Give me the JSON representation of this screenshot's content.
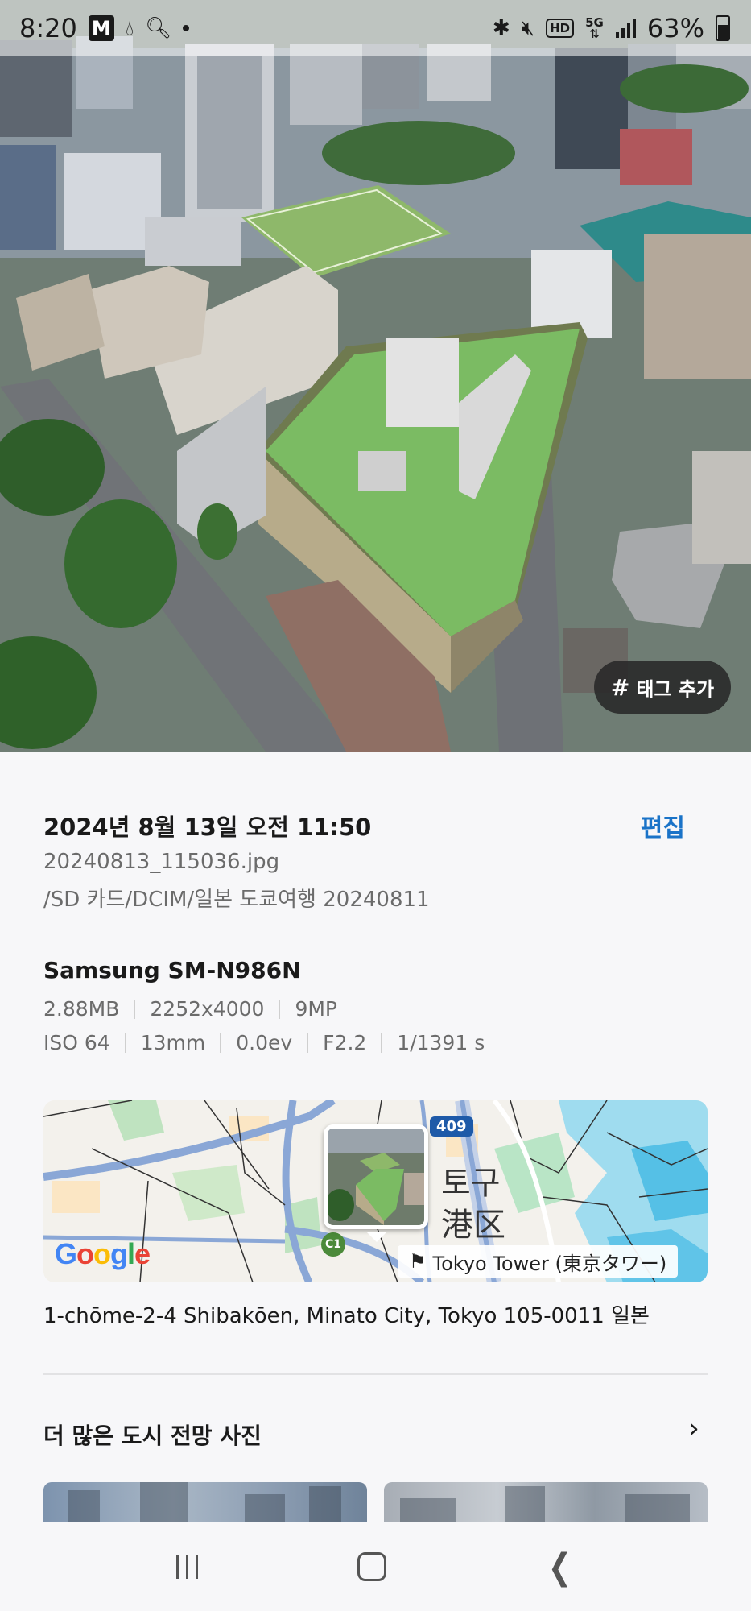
{
  "status_bar": {
    "time": "8:20",
    "app_icon": "M",
    "battery": "63%"
  },
  "photo": {
    "tag_button_label": "태그 추가",
    "tag_button_symbol": "#"
  },
  "details": {
    "datetime": "2024년 8월 13일 오전 11:50",
    "edit_label": "편집",
    "filename": "20240813_115036.jpg",
    "path": "/SD 카드/DCIM/일본 도쿄여행 20240811",
    "device": "Samsung SM-N986N",
    "file_info": [
      "2.88MB",
      "2252x4000",
      "9MP"
    ],
    "exposure_info": [
      "ISO 64",
      "13mm",
      "0.0ev",
      "F2.2",
      "1/1391 s"
    ]
  },
  "map": {
    "route_number": "409",
    "label_ward": "토구",
    "label_kanji": "港区",
    "station_badge": "C1",
    "place_label": "Tokyo Tower (東京タワー)",
    "logo_text": "Google"
  },
  "address": "1-chōme-2-4 Shibakōen, Minato City, Tokyo 105-0011 일본",
  "more": {
    "title": "더 많은 도시 전망 사진",
    "chevron": "›"
  },
  "colors": {
    "accent": "#1a73c8",
    "background": "#f7f7f9"
  }
}
